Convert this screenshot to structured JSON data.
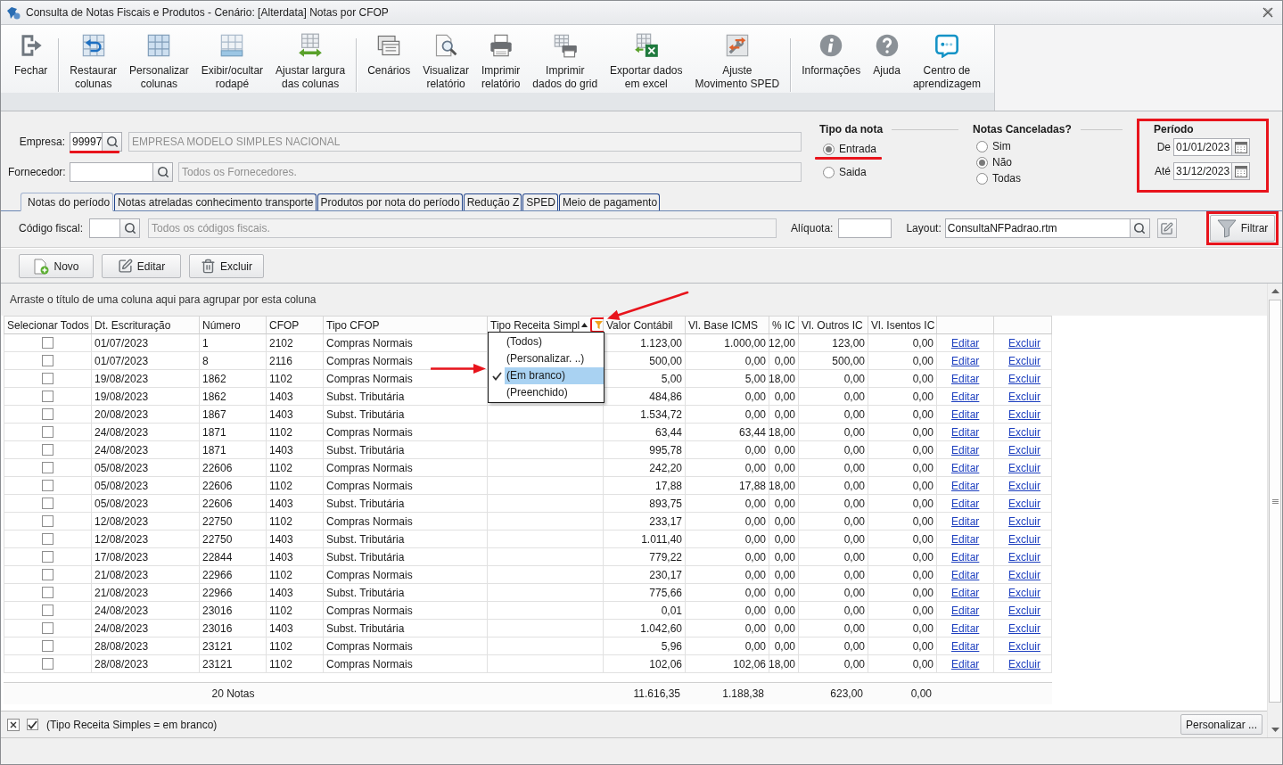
{
  "window": {
    "title": "Consulta de Notas Fiscais e Produtos - Cenário: [Alterdata] Notas por CFOP"
  },
  "toolbar": {
    "groups": [
      [
        {
          "lines": [
            "Fechar"
          ]
        }
      ],
      [
        {
          "lines": [
            "Restaurar",
            "colunas"
          ]
        },
        {
          "lines": [
            "Personalizar",
            "colunas"
          ]
        },
        {
          "lines": [
            "Exibir/ocultar",
            "rodapé"
          ]
        },
        {
          "lines": [
            "Ajustar largura",
            "das colunas"
          ]
        }
      ],
      [
        {
          "lines": [
            "Cenários"
          ]
        },
        {
          "lines": [
            "Visualizar",
            "relatório"
          ]
        },
        {
          "lines": [
            "Imprimir",
            "relatório"
          ]
        },
        {
          "lines": [
            "Imprimir",
            "dados do grid"
          ]
        },
        {
          "lines": [
            "Exportar dados",
            "em excel"
          ]
        },
        {
          "lines": [
            "Ajuste",
            "Movimento SPED"
          ]
        }
      ],
      [
        {
          "lines": [
            "Informações"
          ]
        },
        {
          "lines": [
            "Ajuda"
          ]
        },
        {
          "lines": [
            "Centro de",
            "aprendizagem"
          ]
        }
      ]
    ]
  },
  "filters": {
    "empresa": {
      "label": "Empresa:",
      "code": "99997",
      "description": "EMPRESA MODELO SIMPLES NACIONAL"
    },
    "fornecedor": {
      "label": "Fornecedor:",
      "description": "Todos os Fornecedores."
    },
    "tipo_da_nota": {
      "title": "Tipo da nota",
      "options": [
        {
          "label": "Entrada",
          "selected": true
        },
        {
          "label": "Saida",
          "selected": false
        }
      ]
    },
    "notas_canceladas": {
      "title": "Notas Canceladas?",
      "options": [
        {
          "label": "Sim",
          "selected": false
        },
        {
          "label": "Não",
          "selected": true
        },
        {
          "label": "Todas",
          "selected": false
        }
      ]
    },
    "periodo": {
      "title": "Período",
      "from": {
        "label": "De",
        "value": "01/01/2023"
      },
      "to": {
        "label": "Até",
        "value": "31/12/2023"
      }
    }
  },
  "tabs": [
    {
      "label": "Notas do período",
      "selected": true
    },
    {
      "label": "Notas atreladas conhecimento transporte",
      "selected": false
    },
    {
      "label": "Produtos por nota do período",
      "selected": false
    },
    {
      "label": "Redução Z",
      "selected": false
    },
    {
      "label": "SPED",
      "selected": false
    },
    {
      "label": "Meio de pagamento",
      "selected": false
    }
  ],
  "tab_panel": {
    "codigo_fiscal": {
      "label": "Código fiscal:",
      "description": "Todos os códigos fiscais."
    },
    "aliquota": {
      "label": "Alíquota:"
    },
    "layout": {
      "label": "Layout:",
      "value": "ConsultaNFPadrao.rtm"
    },
    "filter_button": {
      "label": "Filtrar"
    }
  },
  "actions": [
    {
      "label": "Novo"
    },
    {
      "label": "Editar"
    },
    {
      "label": "Excluir"
    }
  ],
  "grid": {
    "group_hint": "Arraste o título de uma coluna aqui para agrupar por esta coluna",
    "columns": [
      {
        "title": "Selecionar Todos",
        "kind": "check"
      },
      {
        "title": "Dt. Escrituração",
        "kind": "text"
      },
      {
        "title": "Número",
        "kind": "text"
      },
      {
        "title": "CFOP",
        "kind": "text"
      },
      {
        "title": "Tipo CFOP",
        "kind": "text"
      },
      {
        "title": "Tipo Receita Simpl",
        "kind": "text",
        "sorted_ascending": true,
        "filtered": true
      },
      {
        "title": "Valor Contábil",
        "kind": "number"
      },
      {
        "title": "Vl. Base ICMS",
        "kind": "number"
      },
      {
        "title": "% IC",
        "kind": "number"
      },
      {
        "title": "Vl. Outros IC",
        "kind": "number"
      },
      {
        "title": "Vl. Isentos IC",
        "kind": "number"
      },
      {
        "kind": "link"
      },
      {
        "kind": "link"
      }
    ],
    "rows": [
      {
        "checked": false,
        "date": "01/07/2023",
        "number": "1",
        "cfop": "2102",
        "cfop_type": "Compras Normais",
        "value": "1.123,00",
        "icms_base": "1.000,00",
        "icms_rate": "12,00",
        "other_icms": "123,00",
        "exempt_icms": "0,00",
        "edit": "Editar",
        "delete": "Excluir"
      },
      {
        "checked": false,
        "date": "01/07/2023",
        "number": "8",
        "cfop": "2116",
        "cfop_type": "Compras Normais",
        "value": "500,00",
        "icms_base": "0,00",
        "icms_rate": "0,00",
        "other_icms": "500,00",
        "exempt_icms": "0,00",
        "edit": "Editar",
        "delete": "Excluir"
      },
      {
        "checked": false,
        "date": "19/08/2023",
        "number": "1862",
        "cfop": "1102",
        "cfop_type": "Compras Normais",
        "value": "5,00",
        "icms_base": "5,00",
        "icms_rate": "18,00",
        "other_icms": "0,00",
        "exempt_icms": "0,00",
        "edit": "Editar",
        "delete": "Excluir"
      },
      {
        "checked": false,
        "date": "19/08/2023",
        "number": "1862",
        "cfop": "1403",
        "cfop_type": "Subst. Tributária",
        "value": "484,86",
        "icms_base": "0,00",
        "icms_rate": "0,00",
        "other_icms": "0,00",
        "exempt_icms": "0,00",
        "edit": "Editar",
        "delete": "Excluir"
      },
      {
        "checked": false,
        "date": "20/08/2023",
        "number": "1867",
        "cfop": "1403",
        "cfop_type": "Subst. Tributária",
        "value": "1.534,72",
        "icms_base": "0,00",
        "icms_rate": "0,00",
        "other_icms": "0,00",
        "exempt_icms": "0,00",
        "edit": "Editar",
        "delete": "Excluir"
      },
      {
        "checked": false,
        "date": "24/08/2023",
        "number": "1871",
        "cfop": "1102",
        "cfop_type": "Compras Normais",
        "value": "63,44",
        "icms_base": "63,44",
        "icms_rate": "18,00",
        "other_icms": "0,00",
        "exempt_icms": "0,00",
        "edit": "Editar",
        "delete": "Excluir"
      },
      {
        "checked": false,
        "date": "24/08/2023",
        "number": "1871",
        "cfop": "1403",
        "cfop_type": "Subst. Tributária",
        "value": "995,78",
        "icms_base": "0,00",
        "icms_rate": "0,00",
        "other_icms": "0,00",
        "exempt_icms": "0,00",
        "edit": "Editar",
        "delete": "Excluir"
      },
      {
        "checked": false,
        "date": "05/08/2023",
        "number": "22606",
        "cfop": "1102",
        "cfop_type": "Compras Normais",
        "value": "242,20",
        "icms_base": "0,00",
        "icms_rate": "0,00",
        "other_icms": "0,00",
        "exempt_icms": "0,00",
        "edit": "Editar",
        "delete": "Excluir"
      },
      {
        "checked": false,
        "date": "05/08/2023",
        "number": "22606",
        "cfop": "1102",
        "cfop_type": "Compras Normais",
        "value": "17,88",
        "icms_base": "17,88",
        "icms_rate": "18,00",
        "other_icms": "0,00",
        "exempt_icms": "0,00",
        "edit": "Editar",
        "delete": "Excluir"
      },
      {
        "checked": false,
        "date": "05/08/2023",
        "number": "22606",
        "cfop": "1403",
        "cfop_type": "Subst. Tributária",
        "value": "893,75",
        "icms_base": "0,00",
        "icms_rate": "0,00",
        "other_icms": "0,00",
        "exempt_icms": "0,00",
        "edit": "Editar",
        "delete": "Excluir"
      },
      {
        "checked": false,
        "date": "12/08/2023",
        "number": "22750",
        "cfop": "1102",
        "cfop_type": "Compras Normais",
        "value": "233,17",
        "icms_base": "0,00",
        "icms_rate": "0,00",
        "other_icms": "0,00",
        "exempt_icms": "0,00",
        "edit": "Editar",
        "delete": "Excluir"
      },
      {
        "checked": false,
        "date": "12/08/2023",
        "number": "22750",
        "cfop": "1403",
        "cfop_type": "Subst. Tributária",
        "value": "1.011,40",
        "icms_base": "0,00",
        "icms_rate": "0,00",
        "other_icms": "0,00",
        "exempt_icms": "0,00",
        "edit": "Editar",
        "delete": "Excluir"
      },
      {
        "checked": false,
        "date": "17/08/2023",
        "number": "22844",
        "cfop": "1403",
        "cfop_type": "Subst. Tributária",
        "value": "779,22",
        "icms_base": "0,00",
        "icms_rate": "0,00",
        "other_icms": "0,00",
        "exempt_icms": "0,00",
        "edit": "Editar",
        "delete": "Excluir"
      },
      {
        "checked": false,
        "date": "21/08/2023",
        "number": "22966",
        "cfop": "1102",
        "cfop_type": "Compras Normais",
        "value": "230,17",
        "icms_base": "0,00",
        "icms_rate": "0,00",
        "other_icms": "0,00",
        "exempt_icms": "0,00",
        "edit": "Editar",
        "delete": "Excluir"
      },
      {
        "checked": false,
        "date": "21/08/2023",
        "number": "22966",
        "cfop": "1403",
        "cfop_type": "Subst. Tributária",
        "value": "775,66",
        "icms_base": "0,00",
        "icms_rate": "0,00",
        "other_icms": "0,00",
        "exempt_icms": "0,00",
        "edit": "Editar",
        "delete": "Excluir"
      },
      {
        "checked": false,
        "date": "24/08/2023",
        "number": "23016",
        "cfop": "1102",
        "cfop_type": "Compras Normais",
        "value": "0,01",
        "icms_base": "0,00",
        "icms_rate": "0,00",
        "other_icms": "0,00",
        "exempt_icms": "0,00",
        "edit": "Editar",
        "delete": "Excluir"
      },
      {
        "checked": false,
        "date": "24/08/2023",
        "number": "23016",
        "cfop": "1403",
        "cfop_type": "Subst. Tributária",
        "value": "1.042,60",
        "icms_base": "0,00",
        "icms_rate": "0,00",
        "other_icms": "0,00",
        "exempt_icms": "0,00",
        "edit": "Editar",
        "delete": "Excluir"
      },
      {
        "checked": false,
        "date": "28/08/2023",
        "number": "23121",
        "cfop": "1102",
        "cfop_type": "Compras Normais",
        "value": "5,96",
        "icms_base": "0,00",
        "icms_rate": "0,00",
        "other_icms": "0,00",
        "exempt_icms": "0,00",
        "edit": "Editar",
        "delete": "Excluir"
      },
      {
        "checked": false,
        "date": "28/08/2023",
        "number": "23121",
        "cfop": "1102",
        "cfop_type": "Compras Normais",
        "value": "102,06",
        "icms_base": "102,06",
        "icms_rate": "18,00",
        "other_icms": "0,00",
        "exempt_icms": "0,00",
        "edit": "Editar",
        "delete": "Excluir"
      }
    ],
    "footer": {
      "count": "20 Notas",
      "value": "11.616,35",
      "icms_base": "1.188,38",
      "other_icms": "623,00",
      "exempt_icms": "0,00"
    }
  },
  "column_filter": {
    "options": [
      {
        "label": "(Todos)",
        "selected": false
      },
      {
        "label": "(Personalizar. ..)",
        "selected": false
      },
      {
        "label": "(Em branco)",
        "selected": true
      },
      {
        "label": "(Preenchido)",
        "selected": false
      }
    ]
  },
  "filter_bar": {
    "enabled": true,
    "text": "(Tipo Receita Simples = em branco)",
    "button": "Personalizar ..."
  }
}
